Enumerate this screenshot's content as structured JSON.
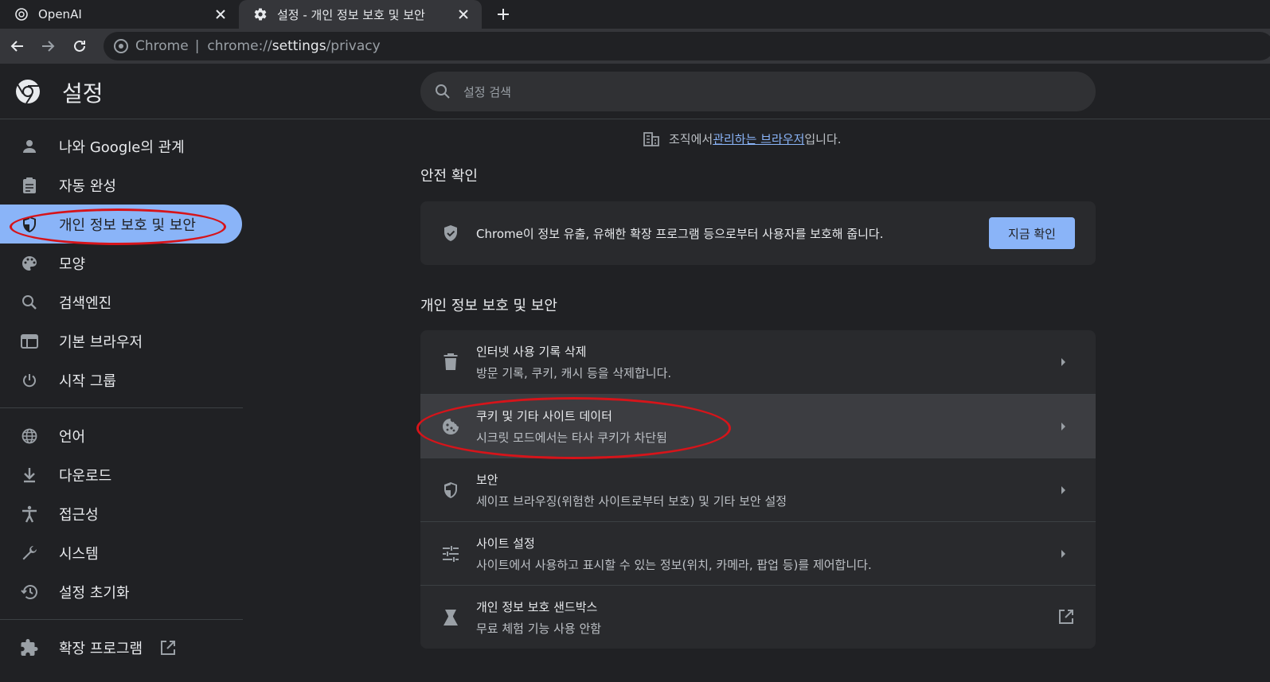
{
  "tabs": [
    {
      "label": "OpenAI",
      "icon": "openai-icon"
    },
    {
      "label": "설정 - 개인 정보 보호 및 보안",
      "icon": "gear-icon"
    }
  ],
  "omnibox": {
    "chip": "Chrome",
    "scheme": "chrome://",
    "host": "settings",
    "path": "/privacy"
  },
  "header": {
    "title": "설정",
    "search_placeholder": "설정 검색"
  },
  "sidebar": {
    "items": [
      {
        "label": "나와 Google의 관계",
        "icon": "person-icon"
      },
      {
        "label": "자동 완성",
        "icon": "clipboard-icon"
      },
      {
        "label": "개인 정보 보호 및 보안",
        "icon": "shield-icon",
        "active": true
      },
      {
        "label": "모양",
        "icon": "palette-icon"
      },
      {
        "label": "검색엔진",
        "icon": "search-icon"
      },
      {
        "label": "기본 브라우저",
        "icon": "browser-icon"
      },
      {
        "label": "시작 그룹",
        "icon": "power-icon"
      }
    ],
    "items2": [
      {
        "label": "언어",
        "icon": "globe-icon"
      },
      {
        "label": "다운로드",
        "icon": "download-icon"
      },
      {
        "label": "접근성",
        "icon": "accessibility-icon"
      },
      {
        "label": "시스템",
        "icon": "wrench-icon"
      },
      {
        "label": "설정 초기화",
        "icon": "history-icon"
      }
    ],
    "extensions": {
      "label": "확장 프로그램",
      "icon": "puzzle-icon"
    }
  },
  "main": {
    "managed_prefix": "조직에서 ",
    "managed_link": "관리하는 브라우저",
    "managed_suffix": "입니다.",
    "safety_title": "안전 확인",
    "safety_text": "Chrome이 정보 유출, 유해한 확장 프로그램 등으로부터 사용자를 보호해 줍니다.",
    "safety_button": "지금 확인",
    "privacy_title": "개인 정보 보호 및 보안",
    "rows": [
      {
        "title": "인터넷 사용 기록 삭제",
        "subtitle": "방문 기록, 쿠키, 캐시 등을 삭제합니다.",
        "icon": "trash-icon"
      },
      {
        "title": "쿠키 및 기타 사이트 데이터",
        "subtitle": "시크릿 모드에서는 타사 쿠키가 차단됨",
        "icon": "cookie-icon"
      },
      {
        "title": "보안",
        "subtitle": "세이프 브라우징(위험한 사이트로부터 보호) 및 기타 보안 설정",
        "icon": "shield-icon"
      },
      {
        "title": "사이트 설정",
        "subtitle": "사이트에서 사용하고 표시할 수 있는 정보(위치, 카메라, 팝업 등)를 제어합니다.",
        "icon": "tune-icon"
      },
      {
        "title": "개인 정보 보호 샌드박스",
        "subtitle": "무료 체험 기능 사용 안함",
        "icon": "flask-icon"
      }
    ]
  },
  "colors": {
    "accent": "#8ab4f8",
    "annotation": "#d6141a",
    "background": "#202124"
  }
}
